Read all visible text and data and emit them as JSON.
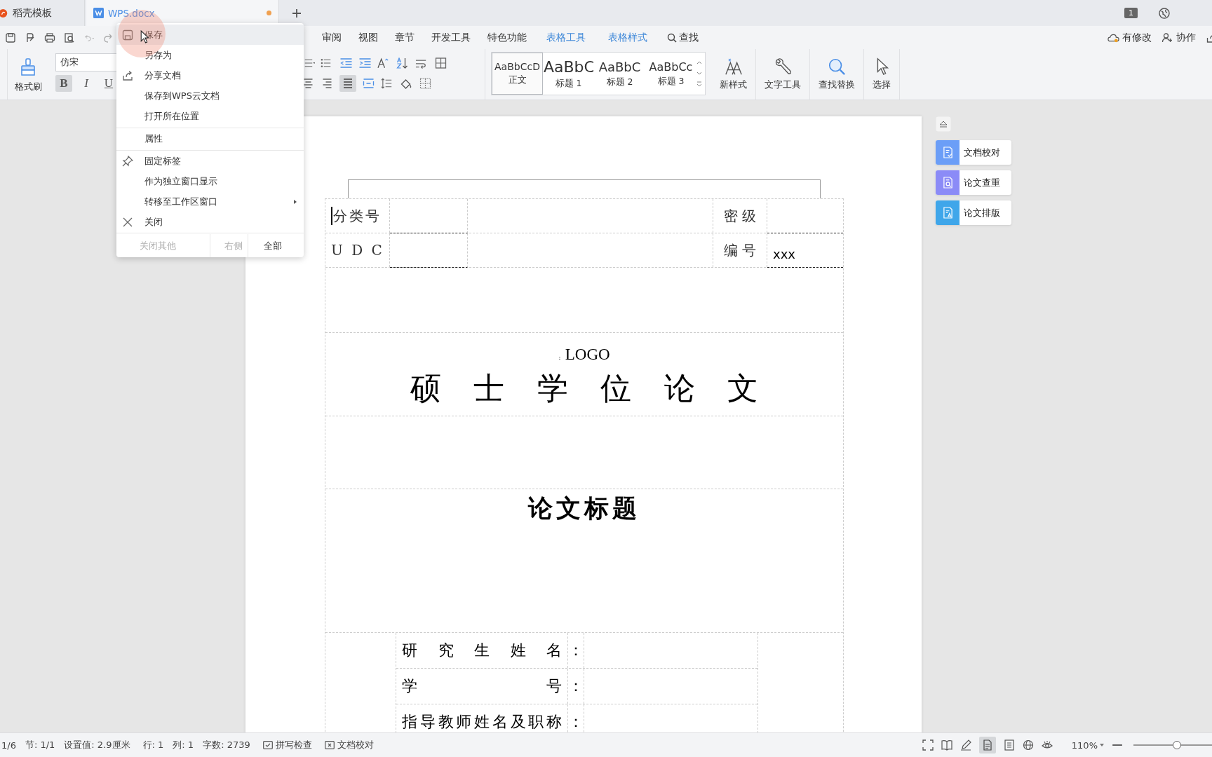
{
  "tabs": [
    {
      "label": "稻壳模板",
      "kind": "docer",
      "selected": false,
      "modified": false
    },
    {
      "label": "WPS.docx",
      "kind": "doc",
      "selected": true,
      "modified": true
    }
  ],
  "window_badge": "1",
  "ribbon_tabs": [
    {
      "label": "审阅",
      "kind": "normal"
    },
    {
      "label": "视图",
      "kind": "normal"
    },
    {
      "label": "章节",
      "kind": "normal"
    },
    {
      "label": "开发工具",
      "kind": "normal"
    },
    {
      "label": "特色功能",
      "kind": "normal"
    },
    {
      "label": "表格工具",
      "kind": "context"
    },
    {
      "label": "表格样式",
      "kind": "context"
    },
    {
      "label": "查找",
      "kind": "search"
    }
  ],
  "header_actions": [
    {
      "label": "有修改",
      "kind": "cloud"
    },
    {
      "label": "协作",
      "kind": "people"
    }
  ],
  "clipboard": {
    "format_painter": "格式刷"
  },
  "font": {
    "name": "仿宋",
    "buttons": [
      {
        "label": "B",
        "kind": "bold",
        "on": true
      },
      {
        "label": "I",
        "kind": "italic",
        "on": false
      },
      {
        "label": "U",
        "kind": "underline",
        "on": false
      }
    ]
  },
  "paragraph": {
    "justify_on": true
  },
  "styles": [
    {
      "preview": "AaBbCcD",
      "label": "正文",
      "kind": "body",
      "selected": true
    },
    {
      "preview": "AaBbC",
      "label": "标题 1",
      "kind": "h1",
      "selected": false
    },
    {
      "preview": "AaBbC",
      "label": "标题 2",
      "kind": "h2",
      "selected": false
    },
    {
      "preview": "AaBbCc",
      "label": "标题 3",
      "kind": "h3",
      "selected": false
    }
  ],
  "tools": [
    {
      "label": "新样式",
      "kind": "new-style"
    },
    {
      "label": "文字工具",
      "kind": "wrench"
    },
    {
      "label": "查找替换",
      "kind": "search"
    },
    {
      "label": "选择",
      "kind": "pointer"
    }
  ],
  "context_menu": {
    "items": [
      {
        "label": "保存",
        "kind": "save",
        "highlighted": true,
        "separator_before": false,
        "submenu": false
      },
      {
        "label": "另存为",
        "kind": "plain",
        "highlighted": false,
        "separator_before": false,
        "submenu": false
      },
      {
        "label": "分享文档",
        "kind": "share",
        "highlighted": false,
        "separator_before": false,
        "submenu": false
      },
      {
        "label": "保存到WPS云文档",
        "kind": "plain",
        "highlighted": false,
        "separator_before": false,
        "submenu": false
      },
      {
        "label": "打开所在位置",
        "kind": "plain",
        "highlighted": false,
        "separator_before": false,
        "submenu": false
      },
      {
        "label": "属性",
        "kind": "plain",
        "highlighted": false,
        "separator_before": true,
        "submenu": false
      },
      {
        "label": "固定标签",
        "kind": "pin",
        "highlighted": false,
        "separator_before": true,
        "submenu": false
      },
      {
        "label": "作为独立窗口显示",
        "kind": "plain",
        "highlighted": false,
        "separator_before": false,
        "submenu": false
      },
      {
        "label": "转移至工作区窗口",
        "kind": "plain",
        "highlighted": false,
        "separator_before": false,
        "submenu": true
      },
      {
        "label": "关闭",
        "kind": "close",
        "highlighted": false,
        "separator_before": false,
        "submenu": false
      }
    ],
    "footer": [
      {
        "label": "关闭其他",
        "disabled": true
      },
      {
        "label": "右侧",
        "disabled": true
      },
      {
        "label": "全部",
        "disabled": false
      }
    ]
  },
  "side_panel": [
    {
      "label": "文档校对",
      "kind": "check",
      "color": "#6b9ef7"
    },
    {
      "label": "论文查重",
      "kind": "search",
      "color": "#8b8bf7"
    },
    {
      "label": "论文排版",
      "kind": "layout",
      "color": "#3fa6ea"
    }
  ],
  "document": {
    "info_rows": [
      {
        "label": "分类号",
        "right_label": "密 级"
      },
      {
        "label": "U D C",
        "right_label": "编 号",
        "right_value": "xxx"
      }
    ],
    "logo_mark": ":",
    "logo": "LOGO",
    "degree_title": "硕士学位论文",
    "thesis_title": "论文标题",
    "student_rows": [
      {
        "label": "研究生姓名",
        "colon": "："
      },
      {
        "label": "学号",
        "colon": "："
      },
      {
        "label": "指导教师姓名及职称",
        "colon": "："
      }
    ]
  },
  "status_bar": {
    "items": [
      {
        "text": "1/6",
        "kind": "text"
      },
      {
        "text": "节: 1/1",
        "kind": "text"
      },
      {
        "text": "设置值: 2.9厘米",
        "kind": "text"
      },
      {
        "text": "行: 1",
        "kind": "text"
      },
      {
        "text": "列: 1",
        "kind": "text"
      },
      {
        "text": "字数: 2739",
        "kind": "text"
      },
      {
        "text": "拼写检查",
        "kind": "spell"
      },
      {
        "text": "文档校对",
        "kind": "proof"
      }
    ],
    "zoom": "110%",
    "zoom_slider": {
      "level": 0.55
    }
  }
}
